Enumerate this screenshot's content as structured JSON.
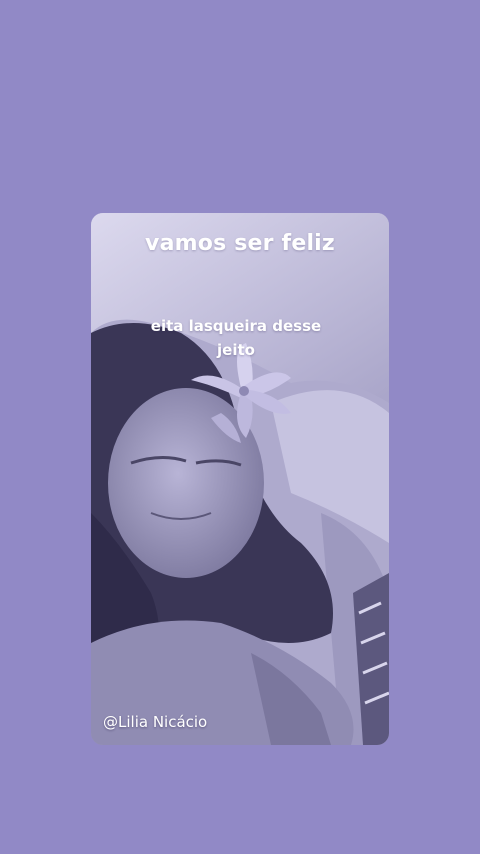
{
  "story": {
    "title": "vamos ser feliz",
    "caption": "eita lasqueira desse jeito",
    "author_handle": "@Lilia Nicácio"
  },
  "colors": {
    "background": "#9189c6",
    "card_tint": "#8a86ad",
    "text": "#ffffff"
  },
  "icons": {
    "decoration": "lily-flower-icon"
  }
}
